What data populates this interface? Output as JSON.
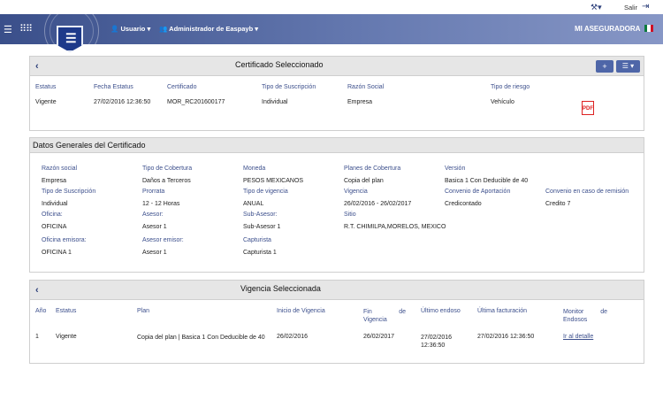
{
  "top": {
    "salir": "Salir"
  },
  "nav": {
    "usuario": "Usuario",
    "admin": "Administrador de Easpayb",
    "brand": "MI ASEGURADORA"
  },
  "colors": {
    "accent": "#4e66a8",
    "label": "#3c4f8c",
    "pdf": "#d22222"
  },
  "cert": {
    "title": "Certificado Seleccionado",
    "add_label": "+",
    "menu_label": "☰ ▾",
    "headers": {
      "estatus": "Estatus",
      "fecha": "Fecha Estatus",
      "certificado": "Certificado",
      "tipo_susc": "Tipo de Suscripción",
      "razon": "Razón Social",
      "riesgo": "Tipo de riesgo"
    },
    "row": {
      "estatus": "Vigente",
      "fecha": "27/02/2016 12:36:50",
      "certificado": "MOR_RC201600177",
      "tipo_susc": "Individual",
      "razon": "Empresa",
      "riesgo": "Vehículo"
    }
  },
  "datos": {
    "title": "Datos Generales del Certificado",
    "razon_lbl": "Razón social",
    "razon_val": "Empresa",
    "cobertura_lbl": "Tipo de Cobertura",
    "cobertura_val": "Daños a Terceros",
    "moneda_lbl": "Moneda",
    "moneda_val": "PESOS MEXICANOS",
    "planes_lbl": "Planes de Cobertura",
    "planes_val": "Copia del plan",
    "version_lbl": "Versión",
    "version_val": "Basica 1 Con Deducible de 40",
    "susc_lbl": "Tipo de Suscripción",
    "susc_val": "Individual",
    "prorrata_lbl": "Prorrata",
    "prorrata_val": "12 - 12 Horas",
    "tvig_lbl": "Tipo de vigencia",
    "tvig_val": "ANUAL",
    "vigencia_lbl": "Vigencia",
    "vigencia_val": "26/02/2016 - 26/02/2017",
    "convenio_lbl": "Convenio de Aportación",
    "convenio_val": "Credicontado",
    "remision_lbl": "Convenio en caso de remisión",
    "remision_val": "Credito 7",
    "oficina_lbl": "Oficina:",
    "oficina_val": "OFICINA",
    "asesor_lbl": "Asesor:",
    "asesor_val": "Asesor 1",
    "subasesor_lbl": "Sub-Asesor:",
    "subasesor_val": "Sub-Asesor 1",
    "sitio_lbl": "Sitio",
    "sitio_val": "R.T. CHIMILPA,MORELOS, MEXICO",
    "emisora_lbl": "Oficina emisora:",
    "emisora_val": "OFICINA 1",
    "asemisor_lbl": "Asesor emisor:",
    "asemisor_val": "Asesor 1",
    "capturista_lbl": "Capturista",
    "capturista_val": "Capturista 1"
  },
  "vig": {
    "title": "Vigencia Seleccionada",
    "headers": {
      "anio": "Año",
      "estatus": "Estatus",
      "plan": "Plan",
      "inicio": "Inicio de Vigencia",
      "fin": "Fin de Vigencia",
      "endoso": "Último endoso",
      "fact": "Última facturación",
      "monitor": "Monitor de Endosos"
    },
    "row": {
      "anio": "1",
      "estatus": "Vigente",
      "plan": "Copia del plan | Basica 1 Con Deducible de 40",
      "inicio": "26/02/2016",
      "fin": "26/02/2017",
      "endoso": "27/02/2016 12:36:50",
      "fact": "27/02/2016 12:36:50",
      "monitor": "Ir al detalle"
    }
  }
}
